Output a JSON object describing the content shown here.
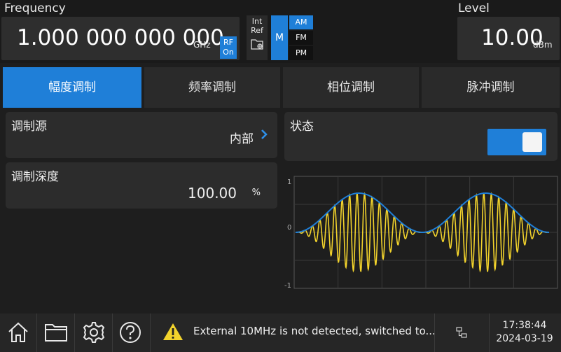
{
  "header": {
    "frequency_label": "Frequency",
    "frequency_value": "1.000 000 000 000",
    "frequency_unit": "GHz",
    "rf_line1": "RF",
    "rf_line2": "On",
    "ref_line1": "Int",
    "ref_line2": "Ref",
    "mod_label": "M",
    "mod_am": "AM",
    "mod_fm": "FM",
    "mod_pm": "PM",
    "level_label": "Level",
    "level_value": "10.00",
    "level_unit": "dBm"
  },
  "tabs": [
    {
      "label": "幅度调制",
      "active": true
    },
    {
      "label": "频率调制",
      "active": false
    },
    {
      "label": "相位调制",
      "active": false
    },
    {
      "label": "脉冲调制",
      "active": false
    }
  ],
  "settings": {
    "source_label": "调制源",
    "source_value": "内部",
    "depth_label": "调制深度",
    "depth_value": "100.00",
    "depth_unit": "%",
    "state_label": "状态",
    "state_on": true
  },
  "chart": {
    "y_ticks": [
      "1",
      "0",
      "-1"
    ],
    "envelope_color": "#1f7fd8",
    "carrier_color": "#f2d32c"
  },
  "footer": {
    "home_icon": "home-icon",
    "folder_icon": "folder-icon",
    "settings_icon": "gear-icon",
    "help_icon": "help-icon",
    "warning_text": "External 10MHz is not detected, switched to...",
    "time": "17:38:44",
    "date": "2024-03-19"
  }
}
